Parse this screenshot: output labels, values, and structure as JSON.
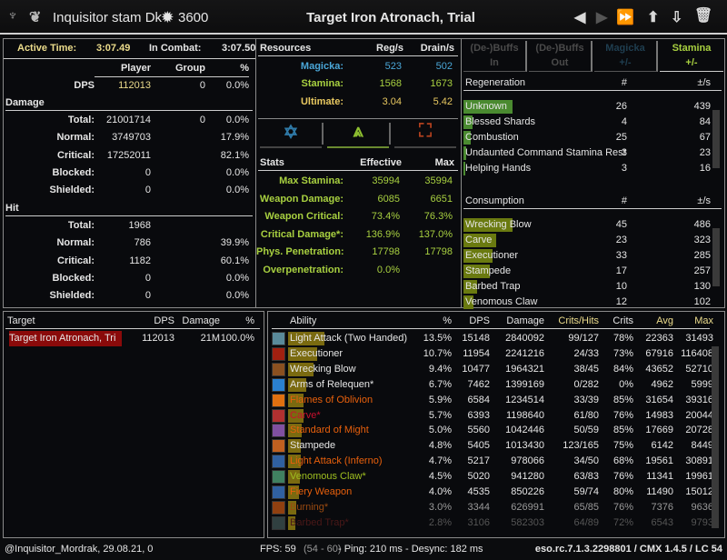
{
  "header": {
    "title_left": "Inquisitor stam Dk",
    "cp": "3600",
    "title": "Target Iron Atronach, Trial",
    "icons": [
      "prev-icon",
      "next-icon",
      "last-icon",
      "upload-icon",
      "save-icon",
      "trash-icon"
    ]
  },
  "overview": {
    "active_time_label": "Active Time:",
    "active_time": "3:07.49",
    "in_combat_label": "In Combat:",
    "in_combat": "3:07.50",
    "cols": [
      "Player",
      "Group",
      "%"
    ],
    "dps": {
      "label": "DPS",
      "player": "112013",
      "group": "0",
      "pct": "0.0%"
    },
    "damage_label": "Damage",
    "damage": [
      {
        "label": "Total:",
        "player": "21001714",
        "group": "0",
        "pct": "0.0%"
      },
      {
        "label": "Normal:",
        "player": "3749703",
        "group": "",
        "pct": "17.9%"
      },
      {
        "label": "Critical:",
        "player": "17252011",
        "group": "",
        "pct": "82.1%"
      },
      {
        "label": "Blocked:",
        "player": "0",
        "group": "",
        "pct": "0.0%"
      },
      {
        "label": "Shielded:",
        "player": "0",
        "group": "",
        "pct": "0.0%"
      }
    ],
    "hit_label": "Hit",
    "hit": [
      {
        "label": "Total:",
        "player": "1968",
        "group": "",
        "pct": ""
      },
      {
        "label": "Normal:",
        "player": "786",
        "group": "",
        "pct": "39.9%"
      },
      {
        "label": "Critical:",
        "player": "1182",
        "group": "",
        "pct": "60.1%"
      },
      {
        "label": "Blocked:",
        "player": "0",
        "group": "",
        "pct": "0.0%"
      },
      {
        "label": "Shielded:",
        "player": "0",
        "group": "",
        "pct": "0.0%"
      }
    ]
  },
  "resources": {
    "label": "Resources",
    "cols": [
      "Reg/s",
      "Drain/s"
    ],
    "rows": [
      {
        "label": "Magicka:",
        "reg": "523",
        "drain": "502",
        "cls": "mag"
      },
      {
        "label": "Stamina:",
        "reg": "1568",
        "drain": "1673",
        "cls": "sta"
      },
      {
        "label": "Ultimate:",
        "reg": "3.04",
        "drain": "5.42",
        "cls": "ult"
      }
    ],
    "tabs": [
      {
        "icon": "magicka-icon",
        "color": "#2f7aa8"
      },
      {
        "icon": "stamina-icon",
        "color": "#8fc030",
        "active": true
      },
      {
        "icon": "physical-icon",
        "color": "#b0401e"
      }
    ],
    "stats_label": "Stats",
    "stats_cols": [
      "Effective",
      "Max"
    ],
    "stats": [
      {
        "label": "Max Stamina:",
        "eff": "35994",
        "max": "35994"
      },
      {
        "label": "Weapon Damage:",
        "eff": "6085",
        "max": "6651"
      },
      {
        "label": "Weapon Critical:",
        "eff": "73.4%",
        "max": "76.3%"
      },
      {
        "label": "Critical Damage*:",
        "eff": "136.9%",
        "max": "137.0%"
      },
      {
        "label": "Phys. Penetration:",
        "eff": "17798",
        "max": "17798"
      },
      {
        "label": "Overpenetration:",
        "eff": "0.0%",
        "max": ""
      }
    ]
  },
  "buffs": {
    "tabs": [
      {
        "l1": "(De-)Buffs",
        "l2": "In",
        "color": "#4a4a4a"
      },
      {
        "l1": "(De-)Buffs",
        "l2": "Out",
        "color": "#4a4a4a"
      },
      {
        "l1": "Magicka",
        "l2": "+/-",
        "color": "#1f3e50"
      },
      {
        "l1": "Stamina",
        "l2": "+/-",
        "color": "#a8d040"
      }
    ],
    "regen_label": "Regeneration",
    "count_col": "#",
    "rate_col": "±/s",
    "regen": [
      {
        "name": "Unknown",
        "count": "26",
        "rate": "439",
        "fill": 1.0
      },
      {
        "name": "Blessed Shards",
        "count": "4",
        "rate": "84",
        "fill": 0.19
      },
      {
        "name": "Combustion",
        "count": "25",
        "rate": "67",
        "fill": 0.15
      },
      {
        "name": "Undaunted Command Stamina Rest",
        "count": "3",
        "rate": "23",
        "fill": 0.05
      },
      {
        "name": "Helping Hands",
        "count": "3",
        "rate": "16",
        "fill": 0.04
      }
    ],
    "cons_label": "Consumption",
    "cons": [
      {
        "name": "Wrecking Blow",
        "count": "45",
        "rate": "486",
        "fill": 1.0
      },
      {
        "name": "Carve",
        "count": "23",
        "rate": "323",
        "fill": 0.66
      },
      {
        "name": "Executioner",
        "count": "33",
        "rate": "285",
        "fill": 0.59
      },
      {
        "name": "Stampede",
        "count": "17",
        "rate": "257",
        "fill": 0.53
      },
      {
        "name": "Barbed Trap",
        "count": "10",
        "rate": "130",
        "fill": 0.27
      },
      {
        "name": "Venomous Claw",
        "count": "12",
        "rate": "102",
        "fill": 0.21
      }
    ]
  },
  "targets": {
    "cols": [
      "Target",
      "DPS",
      "Damage",
      "%"
    ],
    "rows": [
      {
        "name": "Target Iron Atronach, Tri",
        "dps": "112013",
        "damage": "21M",
        "pct": "100.0%"
      }
    ]
  },
  "abilities": {
    "cols": [
      "Ability",
      "%",
      "DPS",
      "Damage",
      "Crits/Hits",
      "Crits",
      "Avg",
      "Max"
    ],
    "rows": [
      {
        "name": "Light Attack (Two Handed)",
        "pct": "13.5%",
        "dps": "15148",
        "damage": "2840092",
        "ch": "99/127",
        "crits": "78%",
        "avg": "22363",
        "max": "31493",
        "color": "#e6e6e6",
        "icon": "two-handed-icon",
        "ic": "#5a8a9a"
      },
      {
        "name": "Executioner",
        "pct": "10.7%",
        "dps": "11954",
        "damage": "2241216",
        "ch": "24/33",
        "crits": "73%",
        "avg": "67916",
        "max": "116408",
        "color": "#e6e6e6",
        "icon": "executioner-icon",
        "ic": "#a02010"
      },
      {
        "name": "Wrecking Blow",
        "pct": "9.4%",
        "dps": "10477",
        "damage": "1964321",
        "ch": "38/45",
        "crits": "84%",
        "avg": "43652",
        "max": "52710",
        "color": "#e6e6e6",
        "icon": "wrecking-blow-icon",
        "ic": "#8a5020"
      },
      {
        "name": "Arms of Relequen*",
        "pct": "6.7%",
        "dps": "7462",
        "damage": "1399169",
        "ch": "0/282",
        "crits": "0%",
        "avg": "4962",
        "max": "5999",
        "color": "#e6e6e6",
        "icon": "relequen-icon",
        "ic": "#2a80d0"
      },
      {
        "name": "Flames of Oblivion",
        "pct": "5.9%",
        "dps": "6584",
        "damage": "1234514",
        "ch": "33/39",
        "crits": "85%",
        "avg": "31654",
        "max": "39316",
        "color": "#e8600c",
        "icon": "flames-icon",
        "ic": "#e07010"
      },
      {
        "name": "Carve*",
        "pct": "5.7%",
        "dps": "6393",
        "damage": "1198640",
        "ch": "61/80",
        "crits": "76%",
        "avg": "14983",
        "max": "20044",
        "color": "#c8102e",
        "icon": "carve-icon",
        "ic": "#b03030"
      },
      {
        "name": "Standard of Might",
        "pct": "5.0%",
        "dps": "5560",
        "damage": "1042446",
        "ch": "50/59",
        "crits": "85%",
        "avg": "17669",
        "max": "20728",
        "color": "#e8600c",
        "icon": "standard-icon",
        "ic": "#8050a0"
      },
      {
        "name": "Stampede",
        "pct": "4.8%",
        "dps": "5405",
        "damage": "1013430",
        "ch": "123/165",
        "crits": "75%",
        "avg": "6142",
        "max": "8449",
        "color": "#e6e6e6",
        "icon": "stampede-icon",
        "ic": "#c06020"
      },
      {
        "name": "Light Attack (Inferno)",
        "pct": "4.7%",
        "dps": "5217",
        "damage": "978066",
        "ch": "34/50",
        "crits": "68%",
        "avg": "19561",
        "max": "30891",
        "color": "#e8600c",
        "icon": "inferno-icon",
        "ic": "#3060a0"
      },
      {
        "name": "Venomous Claw*",
        "pct": "4.5%",
        "dps": "5020",
        "damage": "941280",
        "ch": "63/83",
        "crits": "76%",
        "avg": "11341",
        "max": "19961",
        "color": "#9fbf20",
        "icon": "venomous-claw-icon",
        "ic": "#408060"
      },
      {
        "name": "Fiery Weapon",
        "pct": "4.0%",
        "dps": "4535",
        "damage": "850226",
        "ch": "59/74",
        "crits": "80%",
        "avg": "11490",
        "max": "15012",
        "color": "#e8600c",
        "icon": "fiery-weapon-icon",
        "ic": "#3060a0"
      },
      {
        "name": "Burning*",
        "pct": "3.0%",
        "dps": "3344",
        "damage": "626991",
        "ch": "65/85",
        "crits": "76%",
        "avg": "7376",
        "max": "9636",
        "color": "#9a4a10",
        "dim": "#9a9a9a",
        "icon": "burning-icon",
        "ic": "#904010"
      },
      {
        "name": "Barbed Trap*",
        "pct": "2.8%",
        "dps": "3106",
        "damage": "582303",
        "ch": "64/89",
        "crits": "72%",
        "avg": "6543",
        "max": "9793",
        "color": "#4a1818",
        "dim": "#555",
        "icon": "barbed-trap-icon",
        "ic": "#304040"
      }
    ]
  },
  "footer": {
    "left": "@Inquisitor_Mordrak, 29.08.21, 0",
    "fps": "FPS: 59",
    "fps_range": "(54 - 60)",
    "net": "- Ping: 210 ms - Desync: 182 ms",
    "version": "eso.rc.7.1.3.2298801 / CMX 1.4.5 / LC 54"
  }
}
